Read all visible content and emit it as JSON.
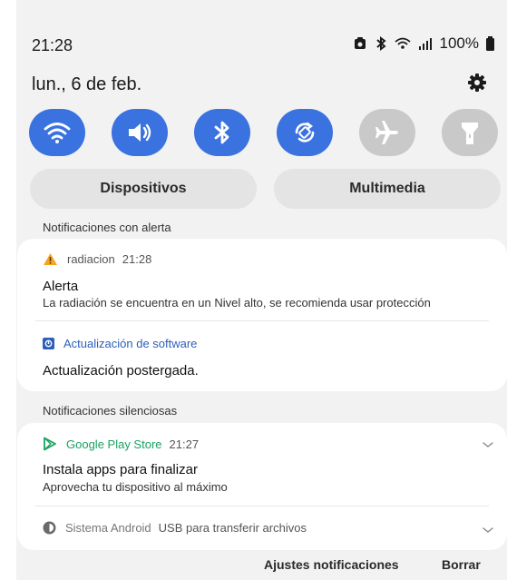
{
  "status_bar": {
    "time": "21:28",
    "battery": "100%"
  },
  "header": {
    "date": "lun., 6 de feb."
  },
  "quick_settings": [
    {
      "name": "wifi-icon",
      "state": "on"
    },
    {
      "name": "sound-icon",
      "state": "on"
    },
    {
      "name": "bluetooth-icon",
      "state": "on"
    },
    {
      "name": "auto-rotate-icon",
      "state": "on"
    },
    {
      "name": "airplane-icon",
      "state": "off"
    },
    {
      "name": "flashlight-icon",
      "state": "off"
    }
  ],
  "tabs": {
    "devices": "Dispositivos",
    "media": "Multimedia"
  },
  "alert_section": {
    "heading": "Notificaciones con alerta",
    "notifications": [
      {
        "app": "radiacion",
        "time": "21:28",
        "title": "Alerta",
        "body": "La radiación se encuentra en un Nivel alto, se recomienda usar protección"
      },
      {
        "app": "Actualización de software",
        "title": "Actualización postergada."
      }
    ]
  },
  "silent_section": {
    "heading": "Notificaciones silenciosas",
    "notifications": [
      {
        "app": "Google Play Store",
        "time": "21:27",
        "title": "Instala apps para finalizar",
        "body": "Aprovecha tu dispositivo al máximo"
      },
      {
        "app": "Sistema Android",
        "summary": "USB para transferir archivos"
      }
    ]
  },
  "footer": {
    "settings": "Ajustes notificaciones",
    "clear": "Borrar"
  },
  "colors": {
    "accent": "#3a72e0",
    "inactive": "#c9c9c9",
    "panel": "#f2f2f2",
    "play_green": "#1aa260",
    "warning": "#f5a623"
  }
}
